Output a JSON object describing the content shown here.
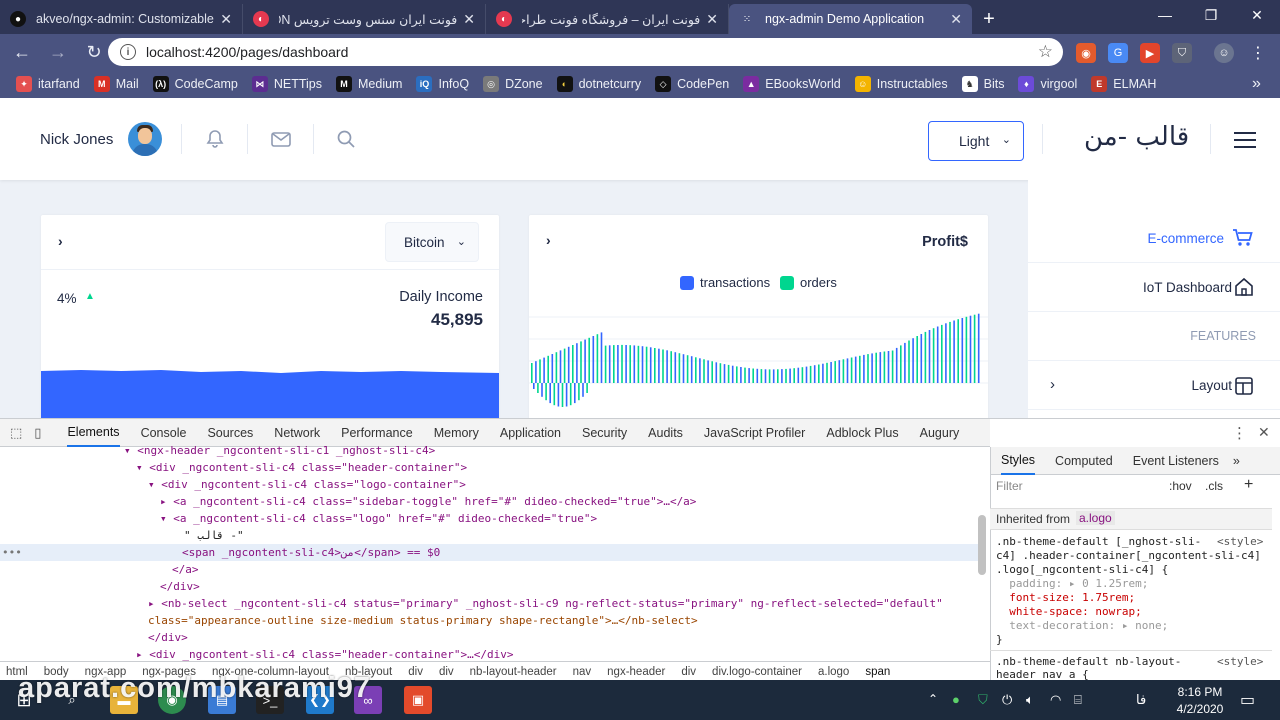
{
  "browser": {
    "tabs": [
      {
        "title": "akveo/ngx-admin: Customizable",
        "icon": "github-icon",
        "active": false
      },
      {
        "title": "فونت ایران سنس وست ترویس DN",
        "icon": "font-site-icon",
        "active": false
      },
      {
        "title": "فونت ایران – فروشگاه فونت طراحی",
        "icon": "font-site-icon",
        "active": false
      },
      {
        "title": "ngx-admin Demo Application",
        "icon": "ngx-icon",
        "active": true
      }
    ],
    "new_tab": "+",
    "url": "localhost:4200/pages/dashboard",
    "bookmarks": [
      {
        "label": "itarfand",
        "color": "#e45050"
      },
      {
        "label": "Mail",
        "color": "#d93025"
      },
      {
        "label": "CodeCamp",
        "color": "#000000"
      },
      {
        "label": "NETTips",
        "color": "#5c2d91"
      },
      {
        "label": "Medium",
        "color": "#000000"
      },
      {
        "label": "InfoQ",
        "color": "#2b6ec0"
      },
      {
        "label": "DZone",
        "color": "#7a7a7a"
      },
      {
        "label": "dotnetcurry",
        "color": "#000000"
      },
      {
        "label": "CodePen",
        "color": "#000000"
      },
      {
        "label": "EBooksWorld",
        "color": "#7b2ca0"
      },
      {
        "label": "Instructables",
        "color": "#f4b400"
      },
      {
        "label": "Bits",
        "color": "#ffffff"
      },
      {
        "label": "virgool",
        "color": "#6c4bd8"
      },
      {
        "label": "ELMAH",
        "color": "#c0392b"
      }
    ],
    "more_bookmarks": "»"
  },
  "header": {
    "user_name": "Nick Jones",
    "theme_select": "Light",
    "logo_text": "قالب -من"
  },
  "bitcoin_card": {
    "currency_select": "Bitcoin",
    "delta": "4%",
    "income_label": "Daily Income",
    "income_value": "45,895"
  },
  "profit_card": {
    "title": "Profit$",
    "legend": [
      {
        "label": "transactions",
        "color": "#3366ff"
      },
      {
        "label": "orders",
        "color": "#00d68f"
      }
    ]
  },
  "sidebar": {
    "items": [
      {
        "label": "E-commerce",
        "icon": "cart-icon",
        "active": true
      },
      {
        "label": "IoT Dashboard",
        "icon": "home-icon",
        "active": false
      },
      {
        "label": "FEATURES",
        "group": true
      },
      {
        "label": "Layout",
        "icon": "layout-icon",
        "active": false
      }
    ]
  },
  "devtools": {
    "tabs": [
      "Elements",
      "Console",
      "Sources",
      "Network",
      "Performance",
      "Memory",
      "Application",
      "Security",
      "Audits",
      "JavaScript Profiler",
      "Adblock Plus",
      "Augury"
    ],
    "styles_tabs": [
      "Styles",
      "Computed",
      "Event Listeners"
    ],
    "filter_placeholder": "Filter",
    "hov": ":hov",
    "cls": ".cls",
    "inherited_label": "Inherited from",
    "inherited_selector": "a.logo",
    "dom_lines": [
      "<ngx-header _ngcontent-sli-c1 _nghost-sli-c4>",
      "<div _ngcontent-sli-c4 class=\"header-container\">",
      "<div _ngcontent-sli-c4 class=\"logo-container\">",
      "<a _ngcontent-sli-c4 class=\"sidebar-toggle\" href=\"#\" dideo-checked=\"true\">…</a>",
      "<a _ngcontent-sli-c4 class=\"logo\" href=\"#\" dideo-checked=\"true\">",
      "\" قالب -\"",
      "<span _ngcontent-sli-c4>من</span> == $0",
      "</a>",
      "</div>",
      "<nb-select _ngcontent-sli-c4 status=\"primary\" _nghost-sli-c9 ng-reflect-status=\"primary\" ng-reflect-selected=\"default\"",
      "class=\"appearance-outline size-medium status-primary shape-rectangle\">…</nb-select>",
      "</div>",
      "<div _ngcontent-sli-c4 class=\"header-container\">…</div>"
    ],
    "css_rule": [
      ".nb-theme-default [_nghost-sli-",
      "c4] .header-container[_ngcontent-sli-c4]",
      ".logo[_ngcontent-sli-c4] {",
      "  padding: ▸ 0 1.25rem;",
      "  font-size: 1.75rem;",
      "  white-space: nowrap;",
      "  text-decoration: ▸ none;",
      "}"
    ],
    "css_source": "<style>",
    "css_rule2": [
      ".nb-theme-default nb-layout-",
      "header nav a {"
    ],
    "breadcrumbs": [
      "html",
      "body",
      "ngx-app",
      "ngx-pages",
      "ngx-one-column-layout",
      "nb-layout",
      "div",
      "div",
      "nb-layout-header",
      "nav",
      "ngx-header",
      "div",
      "div.logo-container",
      "a.logo",
      "span"
    ]
  },
  "taskbar": {
    "time": "8:16 PM",
    "date": "4/2/2020",
    "lang": "فا",
    "watermark": "aparat.com/mbkarami97"
  }
}
